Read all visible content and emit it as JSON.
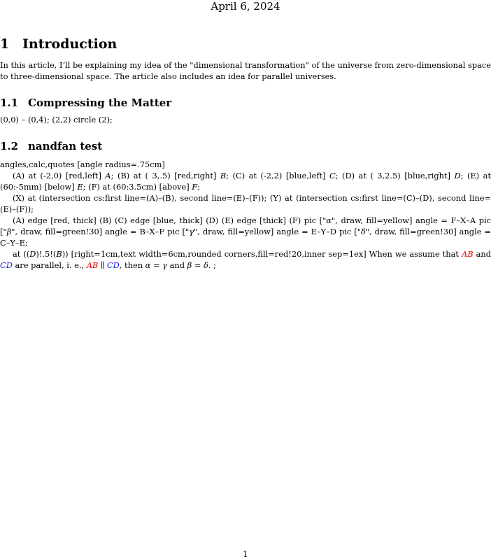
{
  "date": "April 6, 2024",
  "section1": {
    "number": "1",
    "title": "Introduction",
    "body": "In this article, I’ll be explaining my idea of the \"dimensional transformation\" of the universe from zero-dimensional space to three-dimensional space. The article also includes an idea for parallel universes."
  },
  "section1_1": {
    "number": "1.1",
    "title": "Compressing the Matter",
    "body": "(0,0) – (0,4); (2,2) circle (2);"
  },
  "section1_2": {
    "number": "1.2",
    "title": "nandfan test",
    "line0": "angles,calc,quotes [angle radius=.75cm]",
    "para1": {
      "a": "(A) at (-2,0) [red,left]",
      "A": "A",
      "b": "; (B) at ( 3,.5) [red,right]",
      "B": "B",
      "c": "; (C) at (-2,2) [blue,left]",
      "C": "C",
      "d": "; (D) at ( 3,2.5) [blue,right]",
      "D": "D",
      "e": "; (E) at (60:-5mm) [below]",
      "E": "E",
      "f": "; (F) at (60:3.5cm) [above]",
      "F": "F",
      "g": ";"
    },
    "para2": "(X) at (intersection cs:first line=(A)–(B), second line=(E)–(F)); (Y) at (intersection cs:first line=(C)–(D), second line=(E)–(F));",
    "para3": {
      "a": "(A) edge [red, thick] (B) (C) edge [blue, thick] (D) (E) edge [thick] (F) pic [\"",
      "alpha": "α",
      "b": "\", draw, fill=yellow] angle = F–X–A pic [\"",
      "beta": "β",
      "c": "\", draw, fill=green!30] angle = B–X–F pic [\"",
      "gamma": "γ",
      "d": "\", draw, fill=yellow] angle = E–Y–D pic [\"",
      "delta": "δ",
      "e": "\", draw, fill=green!30] angle = C–Y–E;"
    },
    "para4": {
      "a": "at ((",
      "D": "D",
      "b": ")!.5!(",
      "B": "B",
      "c": ")) [right=1cm,text width=6cm,rounded corners,fill=red!20,inner sep=1ex]  When we assume that",
      "AB1": "AB",
      "d": "and",
      "CD1": "CD",
      "e": "are parallel, i. e.,",
      "AB2": "AB",
      "parallel": "∥",
      "CD2": "CD",
      "f": ", then",
      "eq1": "α = γ",
      "g": "and",
      "eq2": "β = δ",
      "h": ". ;"
    }
  },
  "page_number": "1"
}
